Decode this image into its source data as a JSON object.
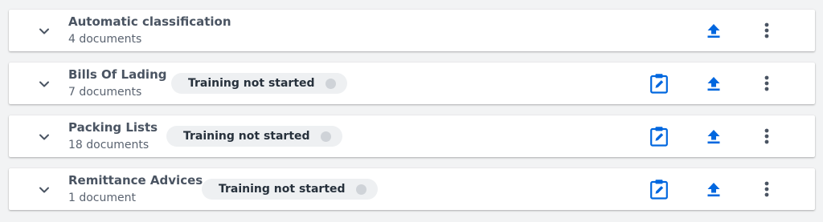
{
  "colors": {
    "accent": "#0067df",
    "title": "#4a5462",
    "subtitle": "#5a6370",
    "badge_bg": "#eef0f2",
    "badge_dot": "#cfd3d8",
    "page_bg": "#f2f3f4"
  },
  "icons": {
    "expand": "chevron-down-icon",
    "review": "clipboard-edit-icon",
    "upload": "upload-icon",
    "more": "more-vertical-icon"
  },
  "rows": [
    {
      "title": "Automatic classification",
      "subtitle": "4 documents"
    },
    {
      "title": "Bills Of Lading",
      "subtitle": "7 documents",
      "status": "Training not started"
    },
    {
      "title": "Packing Lists",
      "subtitle": "18 documents",
      "status": "Training not started"
    },
    {
      "title": "Remittance Advices",
      "subtitle": "1 document",
      "status": "Training not started"
    }
  ]
}
